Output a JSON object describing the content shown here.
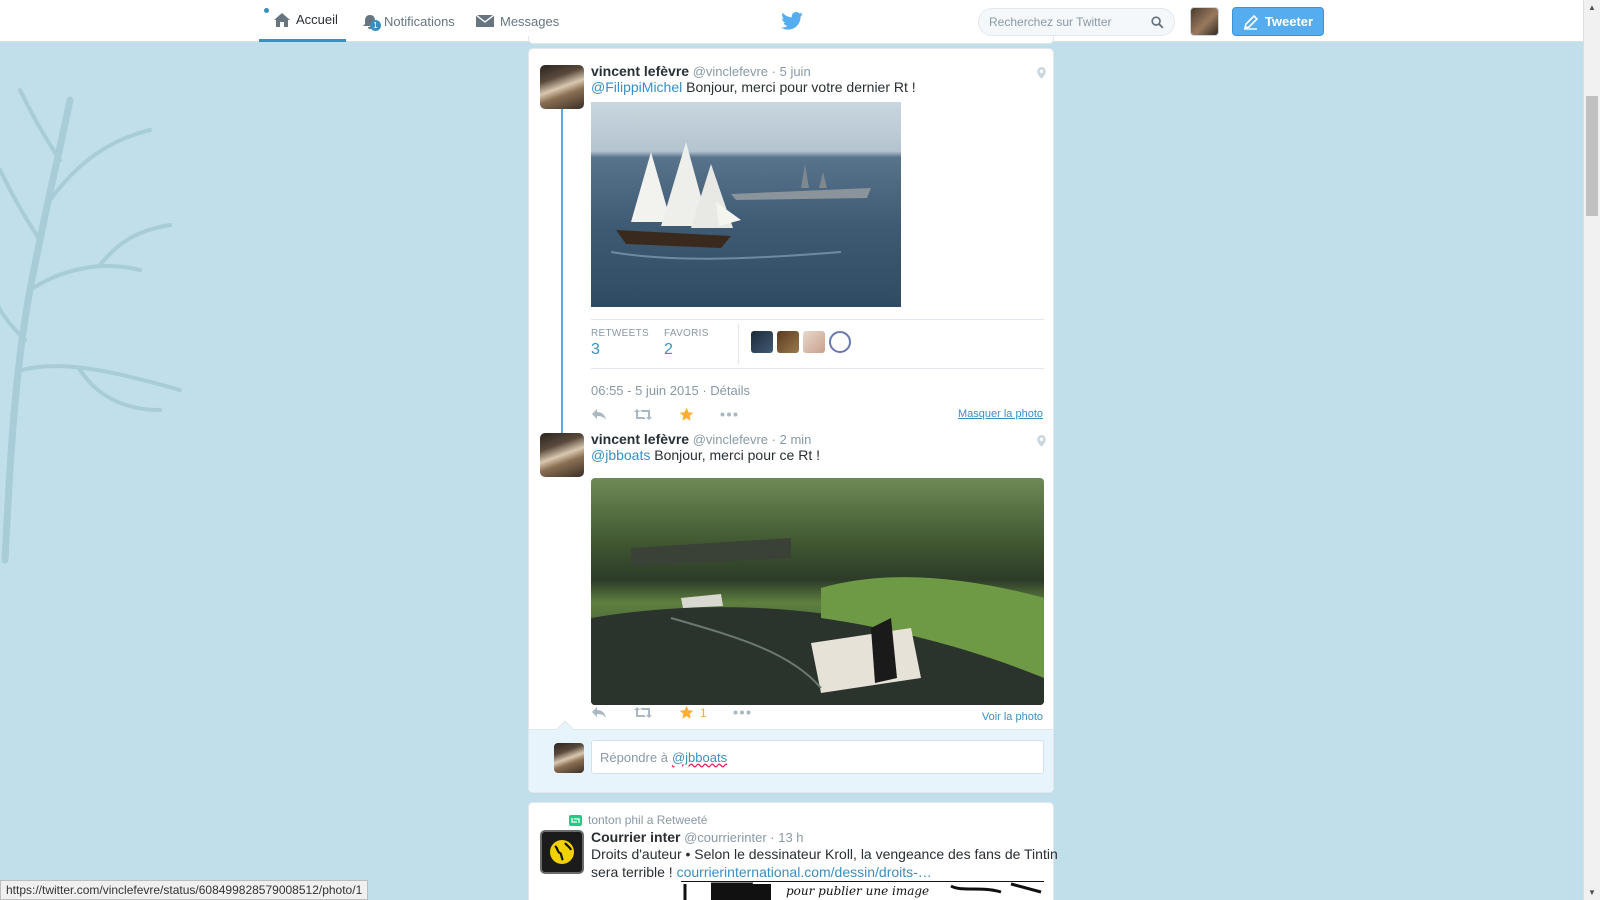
{
  "nav": {
    "home": "Accueil",
    "notifications": "Notifications",
    "notifications_count": "1",
    "messages": "Messages",
    "search_placeholder": "Recherchez sur Twitter",
    "tweet_button": "Tweeter"
  },
  "tweet1": {
    "name": "vincent lefèvre",
    "handle": "@vinclefevre",
    "time": "· 5 juin",
    "mention": "@FilippiMichel",
    "text": " Bonjour, merci pour votre dernier Rt !",
    "retweets_label": "RETWEETS",
    "retweets_count": "3",
    "favorites_label": "FAVORIS",
    "favorites_count": "2",
    "timestamp": "06:55 - 5 juin 2015",
    "details": "Détails",
    "hide_photo": "Masquer la photo"
  },
  "tweet2": {
    "name": "vincent lefèvre",
    "handle": "@vinclefevre",
    "time": "· 2 min",
    "mention": "@jbboats",
    "text": " Bonjour, merci pour ce Rt !",
    "fav_count": "1",
    "view_photo": "Voir la photo"
  },
  "reply": {
    "prefix": "Répondre à",
    "mention": "@jbboats"
  },
  "tweet3": {
    "retweeted_by": "tonton phil a Retweeté",
    "name": "Courrier inter",
    "handle": "@courrierinter",
    "time": "· 13 h",
    "line1": "Droits d'auteur • Selon le dessinateur Kroll, la vengeance des fans de Tintin",
    "line2": "sera terrible !",
    "link": "courrierinternational.com/dessin/droits-…",
    "image_caption": "pour publier une image"
  },
  "status_url": "https://twitter.com/vinclefevre/status/608499828579008512/photo/1",
  "colors": {
    "accent": "#55acee",
    "link": "#3a8fc0",
    "star": "#ffac33",
    "background": "#c0dfea"
  }
}
